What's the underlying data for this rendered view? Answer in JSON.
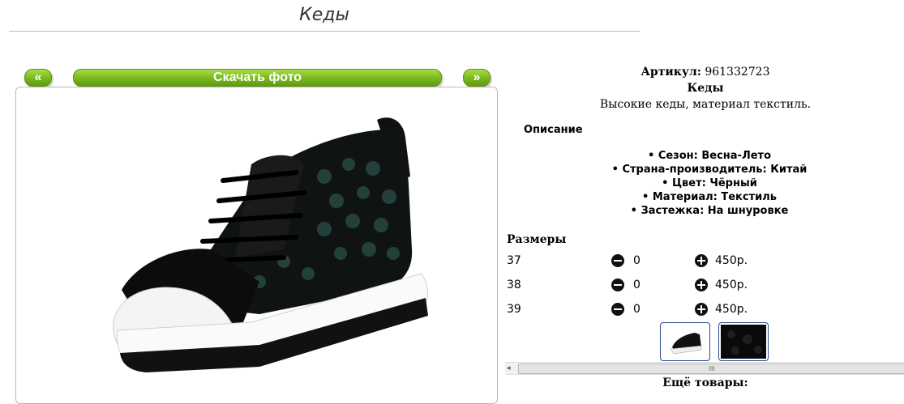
{
  "page": {
    "title": "Кеды"
  },
  "gallery": {
    "prev_label": "«",
    "next_label": "»",
    "download_label": "Скачать фото"
  },
  "product": {
    "article_label": "Артикул:",
    "article_value": "961332723",
    "name": "Кеды",
    "short_description": "Высокие кеды, материал текстиль.",
    "description_heading": "Описание",
    "properties": [
      "Сезон: Весна-Лето",
      "Страна-производитель: Китай",
      "Цвет: Чёрный",
      "Материал: Текстиль",
      "Застежка: На шнуровке"
    ]
  },
  "sizes": {
    "heading": "Размеры",
    "rows": [
      {
        "size": "37",
        "qty": "0",
        "price": "450р."
      },
      {
        "size": "38",
        "qty": "0",
        "price": "450р."
      },
      {
        "size": "39",
        "qty": "0",
        "price": "450р."
      }
    ]
  },
  "thumbnails": [
    "shoe-side-view",
    "fabric-closeup"
  ],
  "scrollbar": {
    "left_arrow": "◂",
    "grip": "III"
  },
  "more_products": "Ещё товары:",
  "colors": {
    "accent_green": "#7fbe22",
    "thumb_border": "#2b4c8a"
  }
}
